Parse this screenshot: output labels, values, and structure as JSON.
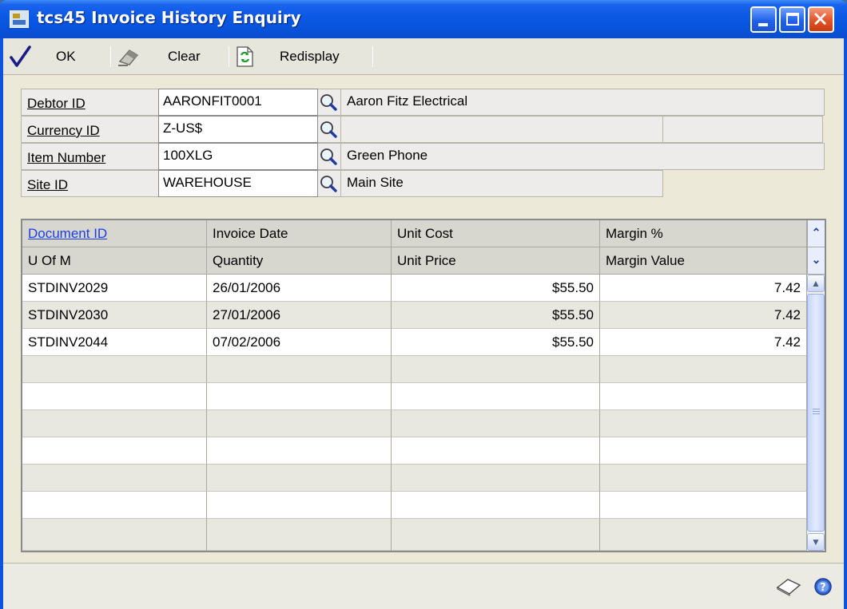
{
  "window": {
    "title": "tcs45 Invoice History Enquiry"
  },
  "toolbar": {
    "ok_label": "OK",
    "clear_label": "Clear",
    "redisplay_label": "Redisplay"
  },
  "form": {
    "debtor": {
      "label": "Debtor ID",
      "value": "AARONFIT0001",
      "description": "Aaron Fitz Electrical"
    },
    "currency": {
      "label": "Currency ID",
      "value": "Z-US$",
      "description": ""
    },
    "item": {
      "label": "Item Number",
      "value": "100XLG",
      "description": "Green Phone"
    },
    "site": {
      "label": "Site ID",
      "value": "WAREHOUSE",
      "description": "Main Site"
    }
  },
  "grid": {
    "header1": [
      "Document ID",
      "Invoice Date",
      "Unit Cost",
      "Margin %"
    ],
    "header2": [
      "U Of M",
      "Quantity",
      "Unit Price",
      "Margin Value"
    ],
    "rows": [
      {
        "document_id": "STDINV2029",
        "invoice_date": "26/01/2006",
        "unit_cost": "$55.50",
        "margin_pct": "7.42"
      },
      {
        "document_id": "STDINV2030",
        "invoice_date": "27/01/2006",
        "unit_cost": "$55.50",
        "margin_pct": "7.42"
      },
      {
        "document_id": "STDINV2044",
        "invoice_date": "07/02/2006",
        "unit_cost": "$55.50",
        "margin_pct": "7.42"
      }
    ]
  },
  "icons": {
    "ok": "checkmark-icon",
    "clear": "eraser-icon",
    "redisplay": "refresh-icon",
    "lookup": "magnifier-icon",
    "note": "note-icon",
    "help": "help-icon"
  }
}
